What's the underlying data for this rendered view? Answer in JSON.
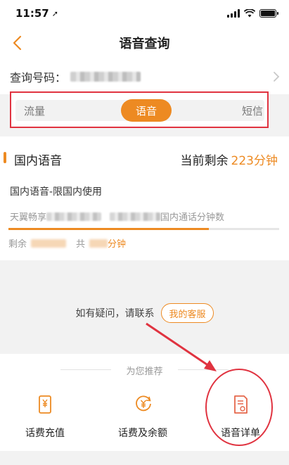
{
  "status_bar": {
    "time": "11:57",
    "location_glyph": "➚"
  },
  "nav": {
    "title": "语音查询"
  },
  "query": {
    "label": "查询号码："
  },
  "tabs": [
    {
      "label": "流量",
      "active": false
    },
    {
      "label": "语音",
      "active": true
    },
    {
      "label": "短信",
      "active": false
    }
  ],
  "card": {
    "title": "国内语音",
    "remain_label": "当前剩余",
    "remain_value": "223分钟",
    "package_name": "国内语音-限国内使用",
    "package_desc_prefix": "天翼畅享",
    "package_desc_suffix": "国内通话分钟数",
    "progress_fraction": 0.74,
    "remain_prefix": "剩余",
    "total_prefix": "共",
    "total_suffix": "分钟"
  },
  "contact": {
    "text": "如有疑问，请联系",
    "button": "我的客服"
  },
  "recommend": {
    "title": "为您推荐",
    "items": [
      {
        "label": "话费充值",
        "icon": "phone-yuan-icon"
      },
      {
        "label": "话费及余额",
        "icon": "yuan-circle-icon"
      },
      {
        "label": "语音详单",
        "icon": "voice-detail-icon"
      }
    ]
  },
  "colors": {
    "accent": "#ed8a22",
    "annotation": "#e03340"
  }
}
